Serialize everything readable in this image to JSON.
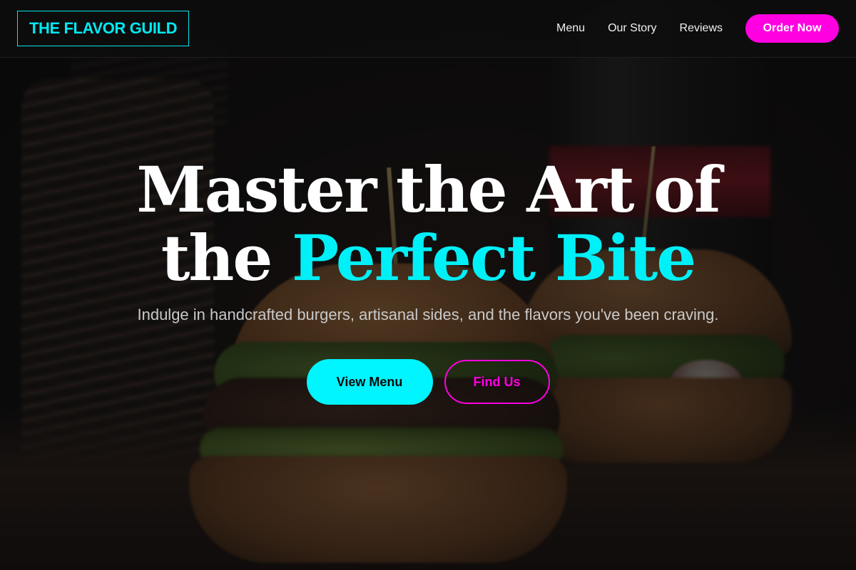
{
  "header": {
    "logo": "THE FLAVOR GUILD",
    "nav": [
      {
        "label": "Menu"
      },
      {
        "label": "Our Story"
      },
      {
        "label": "Reviews"
      }
    ],
    "order_button": "Order Now"
  },
  "hero": {
    "headline_line1": "Master the Art of",
    "headline_line2_plain": "the",
    "headline_line2_accent": "Perfect Bite",
    "subtitle": "Indulge in handcrafted burgers, artisanal sides, and the flavors you've been craving.",
    "primary_button": "View Menu",
    "secondary_button": "Find Us"
  },
  "colors": {
    "accent_cyan": "#00f0f7",
    "accent_magenta": "#ff00e1",
    "background": "#0c0c0c"
  }
}
